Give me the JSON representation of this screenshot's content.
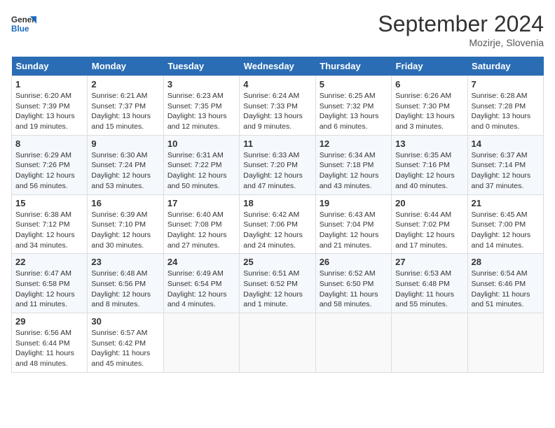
{
  "header": {
    "logo_line1": "General",
    "logo_line2": "Blue",
    "month_title": "September 2024",
    "location": "Mozirje, Slovenia"
  },
  "columns": [
    "Sunday",
    "Monday",
    "Tuesday",
    "Wednesday",
    "Thursday",
    "Friday",
    "Saturday"
  ],
  "weeks": [
    [
      {
        "day": "1",
        "info": "Sunrise: 6:20 AM\nSunset: 7:39 PM\nDaylight: 13 hours and 19 minutes."
      },
      {
        "day": "2",
        "info": "Sunrise: 6:21 AM\nSunset: 7:37 PM\nDaylight: 13 hours and 15 minutes."
      },
      {
        "day": "3",
        "info": "Sunrise: 6:23 AM\nSunset: 7:35 PM\nDaylight: 13 hours and 12 minutes."
      },
      {
        "day": "4",
        "info": "Sunrise: 6:24 AM\nSunset: 7:33 PM\nDaylight: 13 hours and 9 minutes."
      },
      {
        "day": "5",
        "info": "Sunrise: 6:25 AM\nSunset: 7:32 PM\nDaylight: 13 hours and 6 minutes."
      },
      {
        "day": "6",
        "info": "Sunrise: 6:26 AM\nSunset: 7:30 PM\nDaylight: 13 hours and 3 minutes."
      },
      {
        "day": "7",
        "info": "Sunrise: 6:28 AM\nSunset: 7:28 PM\nDaylight: 13 hours and 0 minutes."
      }
    ],
    [
      {
        "day": "8",
        "info": "Sunrise: 6:29 AM\nSunset: 7:26 PM\nDaylight: 12 hours and 56 minutes."
      },
      {
        "day": "9",
        "info": "Sunrise: 6:30 AM\nSunset: 7:24 PM\nDaylight: 12 hours and 53 minutes."
      },
      {
        "day": "10",
        "info": "Sunrise: 6:31 AM\nSunset: 7:22 PM\nDaylight: 12 hours and 50 minutes."
      },
      {
        "day": "11",
        "info": "Sunrise: 6:33 AM\nSunset: 7:20 PM\nDaylight: 12 hours and 47 minutes."
      },
      {
        "day": "12",
        "info": "Sunrise: 6:34 AM\nSunset: 7:18 PM\nDaylight: 12 hours and 43 minutes."
      },
      {
        "day": "13",
        "info": "Sunrise: 6:35 AM\nSunset: 7:16 PM\nDaylight: 12 hours and 40 minutes."
      },
      {
        "day": "14",
        "info": "Sunrise: 6:37 AM\nSunset: 7:14 PM\nDaylight: 12 hours and 37 minutes."
      }
    ],
    [
      {
        "day": "15",
        "info": "Sunrise: 6:38 AM\nSunset: 7:12 PM\nDaylight: 12 hours and 34 minutes."
      },
      {
        "day": "16",
        "info": "Sunrise: 6:39 AM\nSunset: 7:10 PM\nDaylight: 12 hours and 30 minutes."
      },
      {
        "day": "17",
        "info": "Sunrise: 6:40 AM\nSunset: 7:08 PM\nDaylight: 12 hours and 27 minutes."
      },
      {
        "day": "18",
        "info": "Sunrise: 6:42 AM\nSunset: 7:06 PM\nDaylight: 12 hours and 24 minutes."
      },
      {
        "day": "19",
        "info": "Sunrise: 6:43 AM\nSunset: 7:04 PM\nDaylight: 12 hours and 21 minutes."
      },
      {
        "day": "20",
        "info": "Sunrise: 6:44 AM\nSunset: 7:02 PM\nDaylight: 12 hours and 17 minutes."
      },
      {
        "day": "21",
        "info": "Sunrise: 6:45 AM\nSunset: 7:00 PM\nDaylight: 12 hours and 14 minutes."
      }
    ],
    [
      {
        "day": "22",
        "info": "Sunrise: 6:47 AM\nSunset: 6:58 PM\nDaylight: 12 hours and 11 minutes."
      },
      {
        "day": "23",
        "info": "Sunrise: 6:48 AM\nSunset: 6:56 PM\nDaylight: 12 hours and 8 minutes."
      },
      {
        "day": "24",
        "info": "Sunrise: 6:49 AM\nSunset: 6:54 PM\nDaylight: 12 hours and 4 minutes."
      },
      {
        "day": "25",
        "info": "Sunrise: 6:51 AM\nSunset: 6:52 PM\nDaylight: 12 hours and 1 minute."
      },
      {
        "day": "26",
        "info": "Sunrise: 6:52 AM\nSunset: 6:50 PM\nDaylight: 11 hours and 58 minutes."
      },
      {
        "day": "27",
        "info": "Sunrise: 6:53 AM\nSunset: 6:48 PM\nDaylight: 11 hours and 55 minutes."
      },
      {
        "day": "28",
        "info": "Sunrise: 6:54 AM\nSunset: 6:46 PM\nDaylight: 11 hours and 51 minutes."
      }
    ],
    [
      {
        "day": "29",
        "info": "Sunrise: 6:56 AM\nSunset: 6:44 PM\nDaylight: 11 hours and 48 minutes."
      },
      {
        "day": "30",
        "info": "Sunrise: 6:57 AM\nSunset: 6:42 PM\nDaylight: 11 hours and 45 minutes."
      },
      null,
      null,
      null,
      null,
      null
    ]
  ]
}
